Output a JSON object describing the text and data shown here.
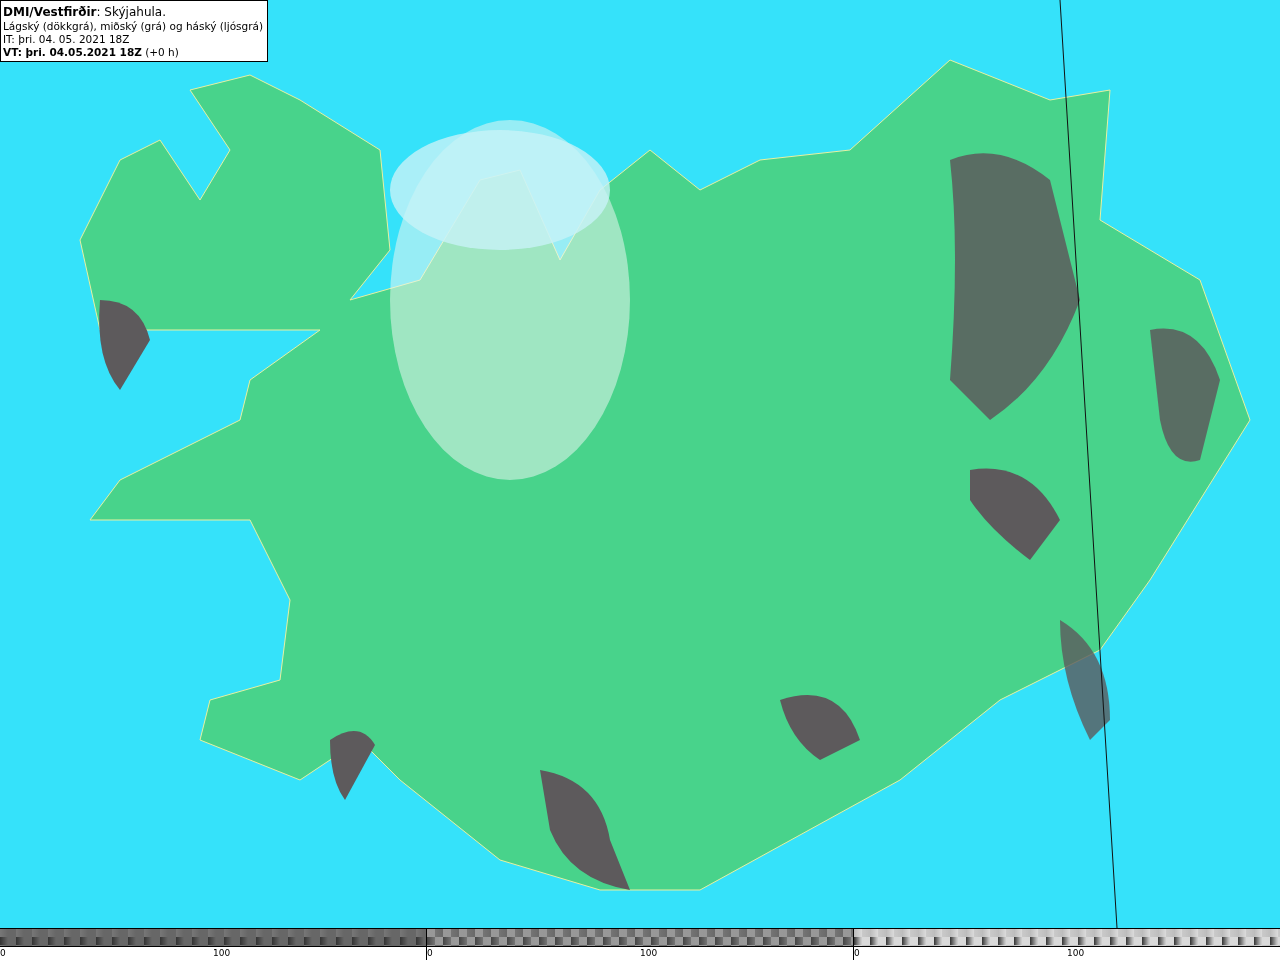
{
  "info_box": {
    "lines": [
      "**DMI/Vestfirðir**: Skýjahula.",
      "Lágský (dökkgrá), miðský (grá) og háský (ljósgrá)",
      "IT: þri. 04. 05. 2021 18Z",
      "**VT: þri. 04.05.2021 18Z** (+0 h)"
    ]
  },
  "color_bars": [
    {
      "kind": "low",
      "ticks": [
        "0",
        "100"
      ]
    },
    {
      "kind": "mid",
      "ticks": [
        "0",
        "100"
      ]
    },
    {
      "kind": "high",
      "ticks": [
        "0",
        "100"
      ]
    }
  ]
}
